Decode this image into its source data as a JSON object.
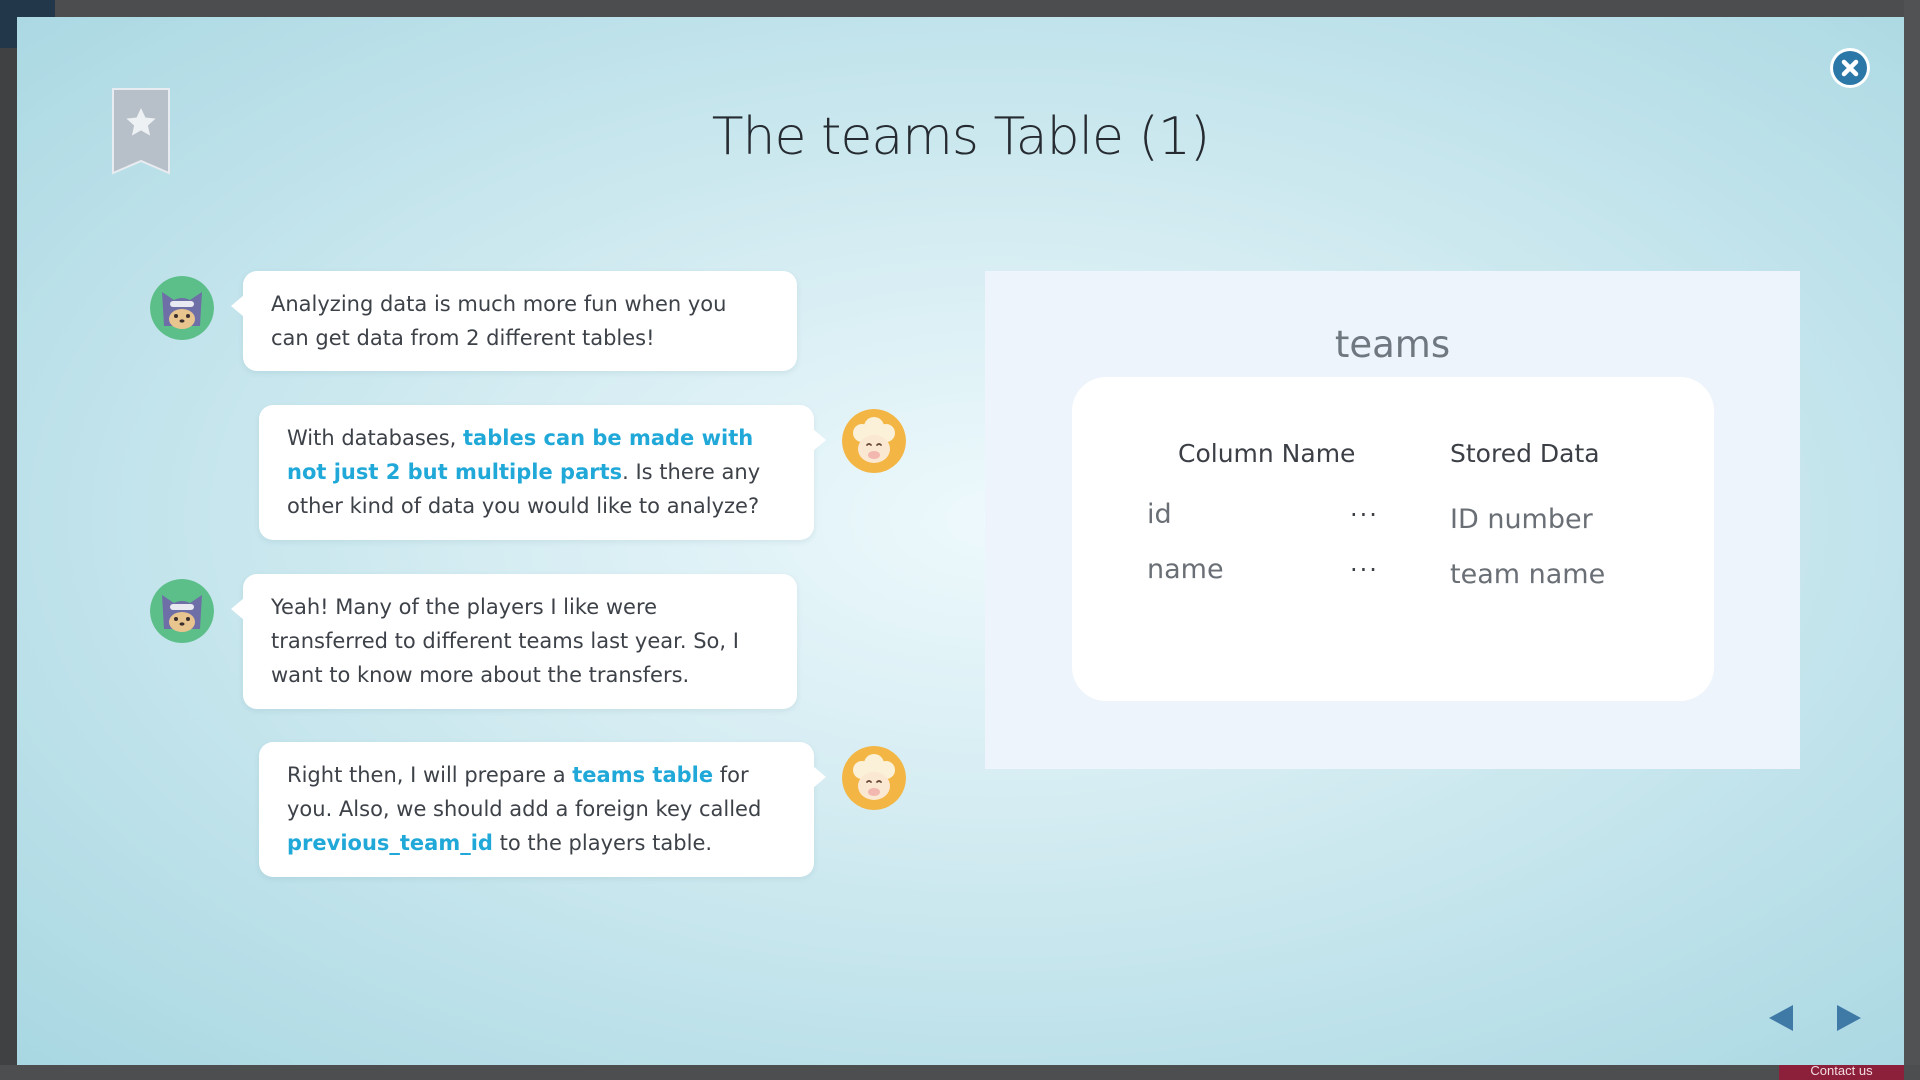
{
  "background": {
    "contact_label": "Contact us"
  },
  "slide": {
    "title": "The teams Table (1)",
    "close_icon": "close-icon",
    "bookmark_icon": "bookmark-star-icon"
  },
  "conversation": [
    {
      "speaker": "cat",
      "avatar": "cat-avatar-icon",
      "parts": [
        {
          "text": "Analyzing data is much more fun when you can get data from 2 different tables!"
        }
      ]
    },
    {
      "speaker": "sheep",
      "avatar": "sheep-avatar-icon",
      "parts": [
        {
          "text": "With databases, "
        },
        {
          "text": "tables can be made with not just 2 but multiple parts",
          "highlight": true
        },
        {
          "text": ". Is there any other kind of data you would like to analyze?"
        }
      ]
    },
    {
      "speaker": "cat",
      "avatar": "cat-avatar-icon",
      "parts": [
        {
          "text": "Yeah! Many of the players I like were transferred to different teams last year. So, I want to know more about the transfers."
        }
      ]
    },
    {
      "speaker": "sheep",
      "avatar": "sheep-avatar-icon",
      "parts": [
        {
          "text": "Right then, I will prepare a "
        },
        {
          "text": "teams table",
          "highlight": true
        },
        {
          "text": " for you. Also, we should add a foreign key called "
        },
        {
          "text": "previous_team_id",
          "highlight": true
        },
        {
          "text": " to the players table."
        }
      ]
    }
  ],
  "table_panel": {
    "title": "teams",
    "headers": {
      "column_name": "Column Name",
      "stored_data": "Stored Data"
    },
    "separator": "···",
    "rows": [
      {
        "column": "id",
        "data": "ID number"
      },
      {
        "column": "name",
        "data": "team name"
      }
    ]
  },
  "navigation": {
    "prev_icon": "triangle-left-icon",
    "next_icon": "triangle-right-icon"
  },
  "colors": {
    "highlight": "#1fa8d8",
    "close_button": "#2b78a8",
    "nav_arrow": "#3f7aa6",
    "cat_avatar_bg": "#5cbf89",
    "sheep_avatar_bg": "#f3b544"
  }
}
